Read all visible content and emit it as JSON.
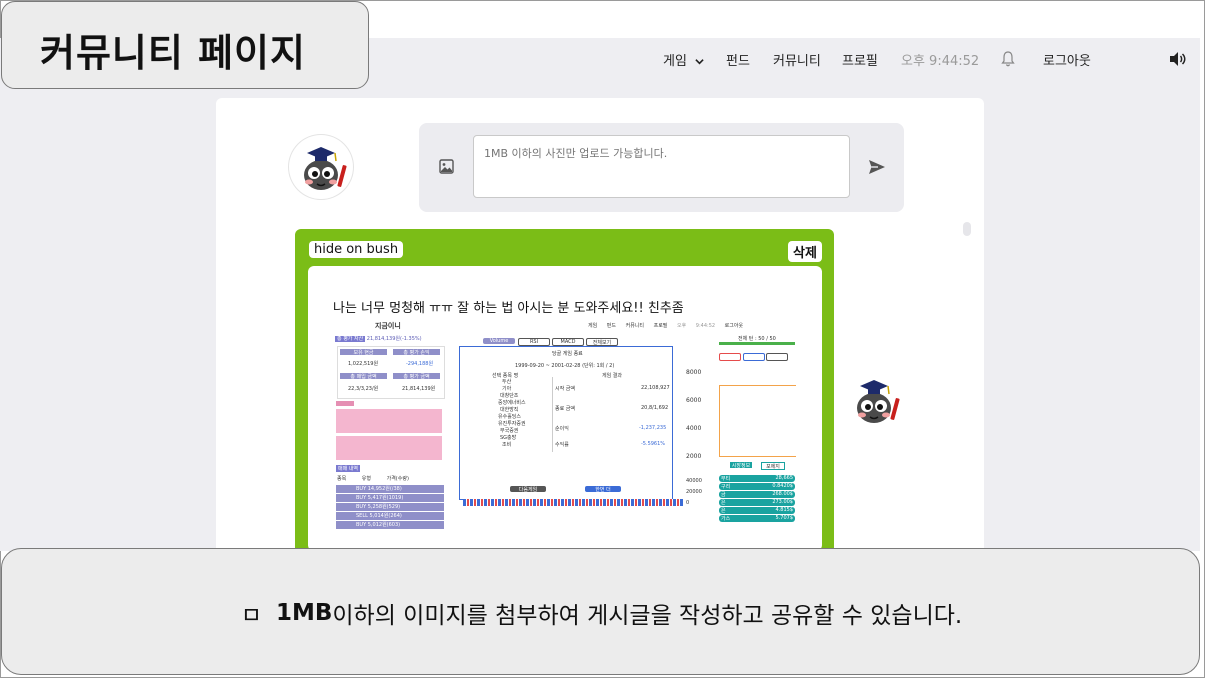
{
  "slide": {
    "title": "커뮤니티 페이지",
    "caption_bold": "1MB",
    "caption_rest": "이하의 이미지를 첨부하여 게시글을 작성하고 공유할 수 있습니다.",
    "caption_bullet": "ㅁ"
  },
  "nav": {
    "game": "게임",
    "fund": "펀드",
    "community": "커뮤니티",
    "profile": "프로필",
    "time": "오후 9:44:52",
    "logout": "로그아웃"
  },
  "composer": {
    "placeholder": "1MB 이하의 사진만 업로드 가능합니다."
  },
  "post": {
    "author": "hide on bush",
    "delete_label": "삭제",
    "title": "나는 너무 멍청해 ㅠㅠ 잘 하는 법 아시는 분 도와주세요!! 친추좀",
    "screenshot": {
      "app_name": "지금이니",
      "nav_items": [
        "게임",
        "펀드",
        "커뮤니티",
        "프로필",
        "오후 9:44:52",
        "로그아웃"
      ],
      "balance_label": "총 평가 자산",
      "balance_value": "21,814,139원(-1.35%)",
      "cash_label": "보유 현금",
      "cash_value": "1,022,519원",
      "pnl_label": "총 평가 손익",
      "pnl_value": "-294,188원",
      "buy_label": "총 매입 금액",
      "buy_value": "22,3/3,23/원",
      "eval_label": "총 평가 금액",
      "eval_value": "21,814,139원",
      "tabs": [
        "Volume",
        "RSI",
        "MACD",
        "전체보기"
      ],
      "modal_title": "당골 게임 종료",
      "modal_period": "1999-09-20 ~ 2001-02-28 (단위: 1회 / 2)",
      "modal_col_head": "선택 종목 명",
      "modal_col_head2": "게임 결과",
      "stocks": [
        "두산",
        "기아",
        "대창단조",
        "중앙에너비스",
        "대한방직",
        "유수홀딩스",
        "유진투자증권",
        "부국증권",
        "SG충방",
        "조비"
      ],
      "result_rows": [
        {
          "label": "시작 금액",
          "value": "22,108,927"
        },
        {
          "label": "종료 금액",
          "value": "20,8/1,692"
        },
        {
          "label": "순이익",
          "value": "-1,237,235"
        },
        {
          "label": "수익률",
          "value": "-5.5961%"
        }
      ],
      "next_btn": "다음게임",
      "exit_btn": "한번 더",
      "y_ticks": [
        "8000",
        "6000",
        "4000",
        "2000"
      ],
      "y_ticks2": [
        "40000",
        "20000",
        "0"
      ],
      "trade_label": "매매 내역",
      "trade_head": [
        "종목",
        "유형",
        "가격(수량)"
      ],
      "trades": [
        {
          "type": "BUY",
          "info": "14,952원(/38)"
        },
        {
          "type": "BUY",
          "info": "5,417원(1019)"
        },
        {
          "type": "BUY",
          "info": "5,258원(529)"
        },
        {
          "type": "SELL",
          "info": "5,014원(264)"
        },
        {
          "type": "BUY",
          "info": "5,012원(603)"
        }
      ],
      "rank_title": "전체 턴 : 50 / 50",
      "rank_list": [
        {
          "name": "부티",
          "value": "28,665"
        },
        {
          "name": "구리",
          "value": "0.8420$"
        },
        {
          "name": "금",
          "value": "268.00$"
        },
        {
          "name": "은",
          "value": "273.00$"
        },
        {
          "name": "은",
          "value": "4.815$"
        },
        {
          "name": "가스",
          "value": "5.707$"
        }
      ],
      "market_tab": "시장정보",
      "market_tab2": "포에지"
    }
  },
  "colors": {
    "post_green": "#7bbd17",
    "nav_bg": "#eeeef2",
    "caption_bg": "#ececec"
  },
  "icons": [
    "chevron-down-icon",
    "bell-icon",
    "speaker-icon",
    "image-icon",
    "send-icon"
  ]
}
